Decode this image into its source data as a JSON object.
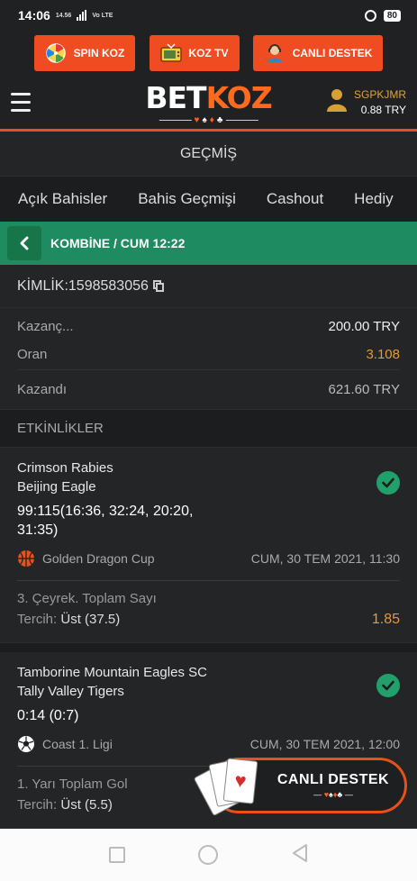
{
  "statusbar": {
    "time": "14:06",
    "net_small": "14.56",
    "net_label": "Vo LTE",
    "battery": "80"
  },
  "promo": [
    {
      "label": "SPIN KOZ",
      "icon": "wheel-icon"
    },
    {
      "label": "KOZ TV",
      "icon": "tv-icon"
    },
    {
      "label": "CANLI DESTEK",
      "icon": "support-agent-icon"
    }
  ],
  "header": {
    "logo_main": "BET",
    "logo_accent": "KOZ",
    "username": "SGPKJMR",
    "balance": "0.88 TRY"
  },
  "section_title": "GEÇMİŞ",
  "tabs": [
    "Açık Bahisler",
    "Bahis Geçmişi",
    "Cashout",
    "Hediy"
  ],
  "coupon": {
    "title": "KOMBİNE / CUM 12:22",
    "id_label": "KİMLİK:",
    "id_value": "1598583056"
  },
  "summary": {
    "stake_label": "Kazanç...",
    "stake_value": "200.00 TRY",
    "odds_label": "Oran",
    "odds_value": "3.108",
    "won_label": "Kazandı",
    "won_value": "621.60 TRY"
  },
  "events_heading": "ETKİNLİKLER",
  "events": [
    {
      "team1": "Crimson Rabies",
      "team2": "Beijing Eagle",
      "score": "99:115(16:36, 32:24, 20:20, 31:35)",
      "sport_icon": "basketball-icon",
      "league": "Golden Dragon Cup",
      "date": "CUM, 30 TEM 2021, 11:30",
      "market": "3. Çeyrek. Toplam Sayı",
      "pick_label": "Tercih:",
      "pick_value": "Üst (37.5)",
      "odds": "1.85",
      "status": "won"
    },
    {
      "team1": "Tamborine Mountain Eagles SC",
      "team2": "Tally Valley Tigers",
      "score": "0:14 (0:7)",
      "sport_icon": "soccer-ball-icon",
      "league": "Coast 1. Ligi",
      "date": "CUM, 30 TEM 2021, 12:00",
      "market": "1. Yarı Toplam Gol",
      "pick_label": "Tercih:",
      "pick_value": "Üst (5.5)",
      "odds": "",
      "status": "won"
    }
  ],
  "live_support": {
    "label": "CANLI DESTEK"
  },
  "colors": {
    "accent": "#ef4c21",
    "green": "#1f8b60",
    "odds": "#e49a35",
    "success": "#22a06b"
  }
}
